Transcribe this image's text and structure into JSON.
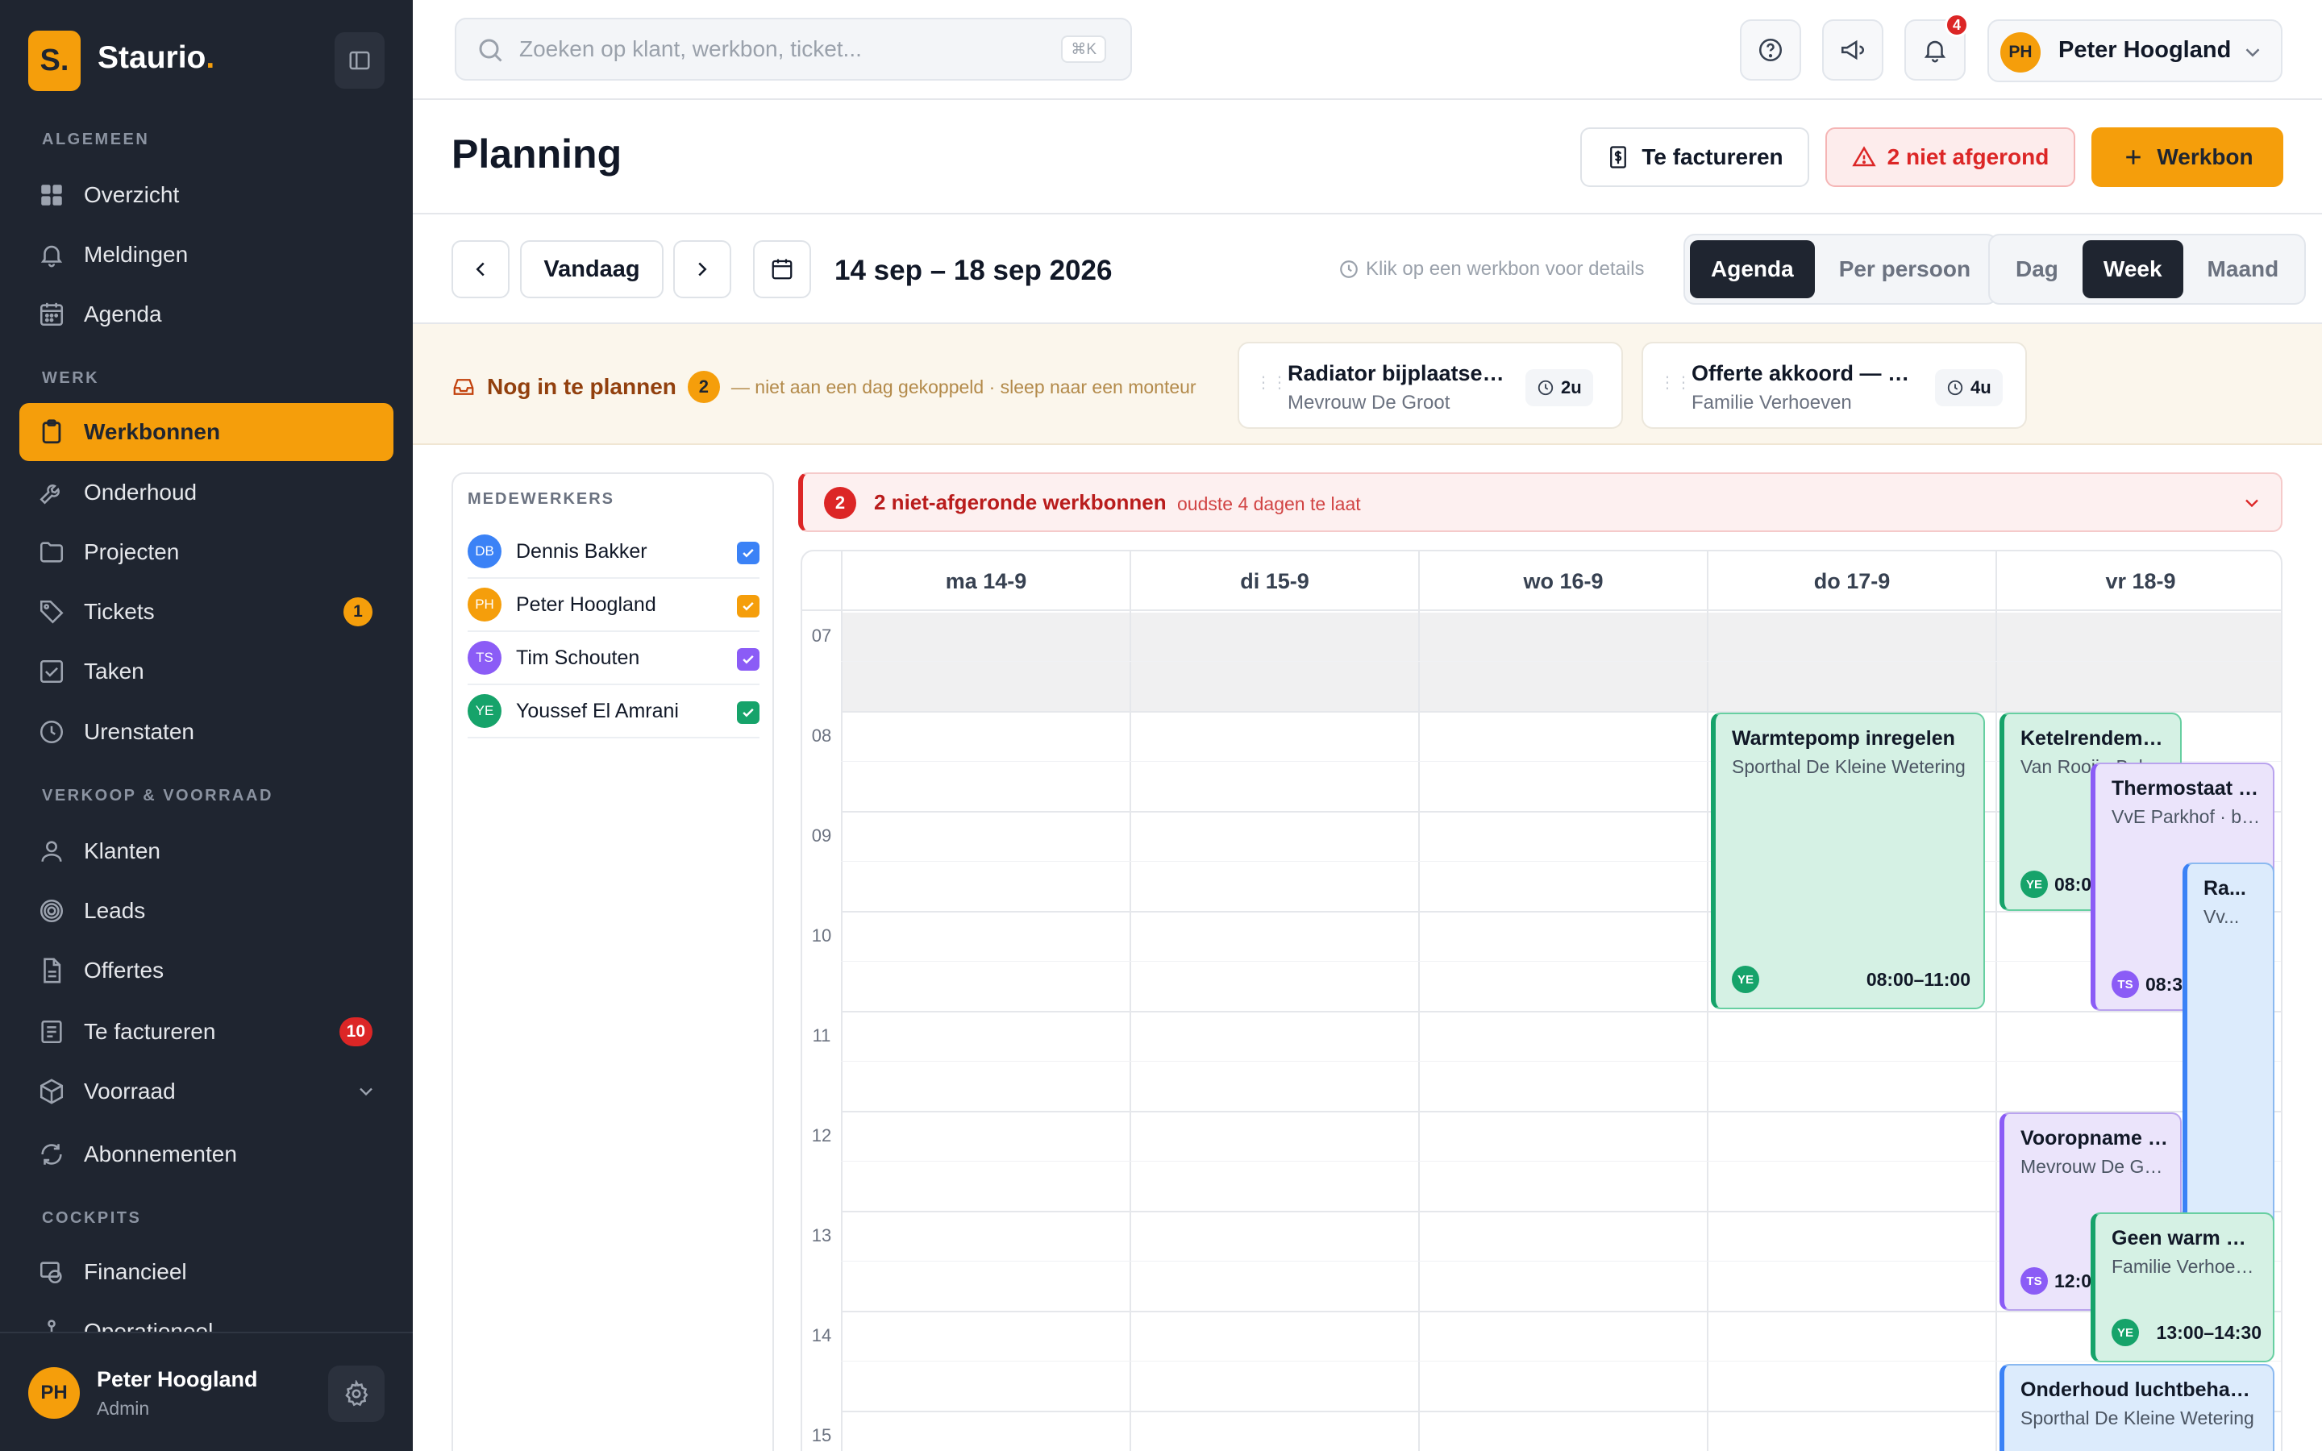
{
  "app": {
    "logo_mark": "S.",
    "logo_name": "Staurio",
    "logo_dot": "."
  },
  "sidebar": {
    "sections": {
      "general": "ALGEMEEN",
      "work": "WERK",
      "sales": "VERKOOP & VOORRAAD",
      "cockpits": "COCKPITS"
    },
    "items": [
      {
        "label": "Overzicht",
        "icon": "grid-icon"
      },
      {
        "label": "Meldingen",
        "icon": "bell-icon"
      },
      {
        "label": "Agenda",
        "icon": "calendar-icon"
      },
      {
        "label": "Werkbonnen",
        "icon": "clipboard-icon",
        "active": true
      },
      {
        "label": "Onderhoud",
        "icon": "wrench-icon"
      },
      {
        "label": "Projecten",
        "icon": "folder-icon"
      },
      {
        "label": "Tickets",
        "icon": "tag-icon",
        "badge": "1"
      },
      {
        "label": "Taken",
        "icon": "checkbox-icon"
      },
      {
        "label": "Urenstaten",
        "icon": "clock-icon"
      },
      {
        "label": "Klanten",
        "icon": "user-icon"
      },
      {
        "label": "Leads",
        "icon": "target-icon"
      },
      {
        "label": "Offertes",
        "icon": "document-icon"
      },
      {
        "label": "Te factureren",
        "icon": "receipt-icon",
        "badge": "10"
      },
      {
        "label": "Voorraad",
        "icon": "box-icon"
      },
      {
        "label": "Abonnementen",
        "icon": "refresh-icon"
      },
      {
        "label": "Financieel",
        "icon": "money-icon"
      },
      {
        "label": "Operationeel",
        "icon": "network-icon"
      }
    ],
    "footer": {
      "initials": "PH",
      "name": "Peter Hoogland",
      "role": "Admin"
    }
  },
  "topbar": {
    "search_placeholder": "Zoeken op klant, werkbon, ticket...",
    "search_shortcut": "⌘K",
    "notification_count": "4",
    "user_initials": "PH",
    "user_name": "Peter Hoogland"
  },
  "header": {
    "title": "Planning",
    "to_invoice_label": "Te factureren",
    "unfinished_label": "2 niet afgerond",
    "new_label": "Werkbon"
  },
  "toolbar": {
    "today_label": "Vandaag",
    "date_range": "14 sep – 18 sep 2026",
    "hint": "Klik op een werkbon voor details",
    "views": [
      "Agenda",
      "Per persoon"
    ],
    "active_view": "Agenda",
    "periods": [
      "Dag",
      "Week",
      "Maand"
    ],
    "active_period": "Week"
  },
  "unplanned": {
    "title": "Nog in te plannen",
    "count": "2",
    "subtitle": "— niet aan een dag gekoppeld · sleep naar een monteur",
    "cards": [
      {
        "title": "Radiator bijplaatsen woonkamer",
        "customer": "Mevrouw De Groot",
        "duration": "2u"
      },
      {
        "title": "Offerte akkoord — ketel vervangen",
        "customer": "Familie Verhoeven",
        "duration": "4u"
      }
    ]
  },
  "employees": {
    "heading": "MEDEWERKERS",
    "list": [
      {
        "initials": "DB",
        "name": "Dennis Bakker",
        "color": "#3b82f6"
      },
      {
        "initials": "PH",
        "name": "Peter Hoogland",
        "color": "#f59e0b"
      },
      {
        "initials": "TS",
        "name": "Tim Schouten",
        "color": "#8b5cf6"
      },
      {
        "initials": "YE",
        "name": "Youssef El Amrani",
        "color": "#16a36a"
      }
    ]
  },
  "alert": {
    "count": "2",
    "title": "2 niet-afgeronde werkbonnen",
    "subtitle": "oudste 4 dagen te laat"
  },
  "calendar": {
    "days": [
      "ma 14-9",
      "di 15-9",
      "wo 16-9",
      "do 17-9",
      "vr 18-9"
    ],
    "hours": [
      "07",
      "08",
      "09",
      "10",
      "11",
      "12",
      "13",
      "14",
      "15"
    ],
    "events": [
      {
        "title": "Warmtepomp inregelen",
        "subtitle": "Sporthal De Kleine Wetering",
        "initials": "YE",
        "time": "08:00–11:00",
        "color": "green"
      },
      {
        "title": "Ketelrendement meten",
        "subtitle": "Van Rooij · Bakkerij",
        "initials": "YE",
        "time": "08:0",
        "color": "green"
      },
      {
        "title": "Thermostaat vervangen",
        "subtitle": "VvE Parkhof · blok B",
        "initials": "TS",
        "time": "08:3",
        "color": "purple"
      },
      {
        "title": "Ra...",
        "subtitle": "Vv...",
        "initials": "",
        "time": "",
        "color": "blue"
      },
      {
        "title": "Vooropname badkamer",
        "subtitle": "Mevrouw De Groot",
        "initials": "TS",
        "time": "12:0",
        "color": "purple"
      },
      {
        "title": "Geen warm water",
        "subtitle": "Familie Verhoeven",
        "initials": "YE",
        "time": "13:00–14:30",
        "color": "green"
      },
      {
        "title": "Onderhoud luchtbehandeling",
        "subtitle": "Sporthal De Kleine Wetering",
        "initials": "",
        "time": "",
        "color": "blue"
      }
    ]
  }
}
